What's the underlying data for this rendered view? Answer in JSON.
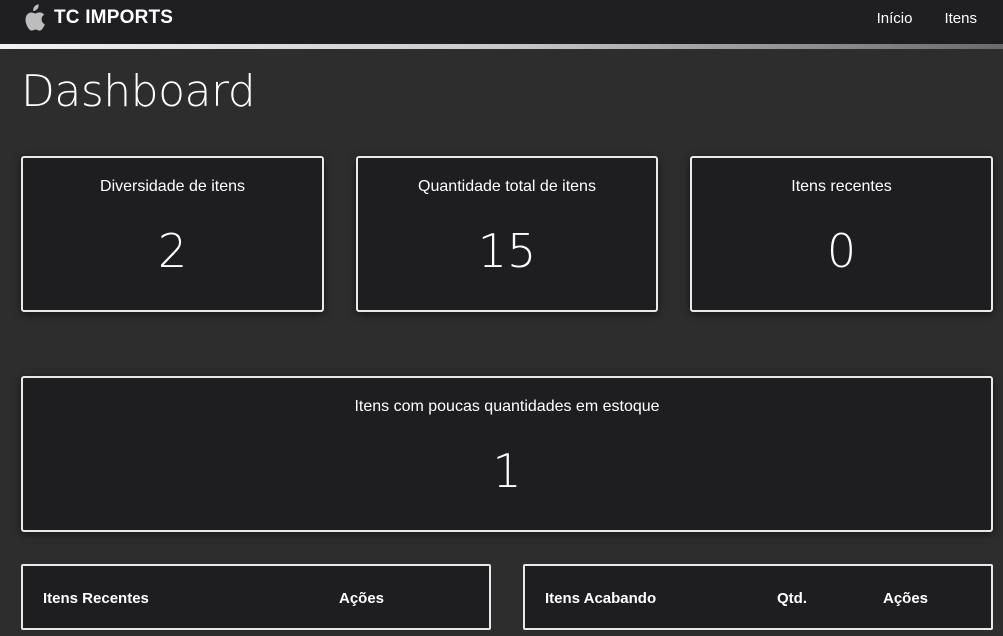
{
  "brand": {
    "name": "TC IMPORTS",
    "logo_icon": "apple-icon"
  },
  "nav": {
    "links": [
      "Início",
      "Itens"
    ]
  },
  "page": {
    "title": "Dashboard"
  },
  "stats": [
    {
      "label": "Diversidade de itens",
      "value": "2"
    },
    {
      "label": "Quantidade total de itens",
      "value": "15"
    },
    {
      "label": "Itens recentes",
      "value": "0"
    }
  ],
  "low_stock": {
    "label": "Itens com poucas quantidades em estoque",
    "value": "1"
  },
  "recent_table": {
    "headers": [
      "Itens Recentes",
      "Ações"
    ]
  },
  "ending_table": {
    "headers": [
      "Itens Acabando",
      "Qtd.",
      "Ações"
    ]
  },
  "colors": {
    "background": "#2d2d2d",
    "card": "#1e1d20",
    "border": "#e9e9e9",
    "navbar": "#1f1e21"
  }
}
